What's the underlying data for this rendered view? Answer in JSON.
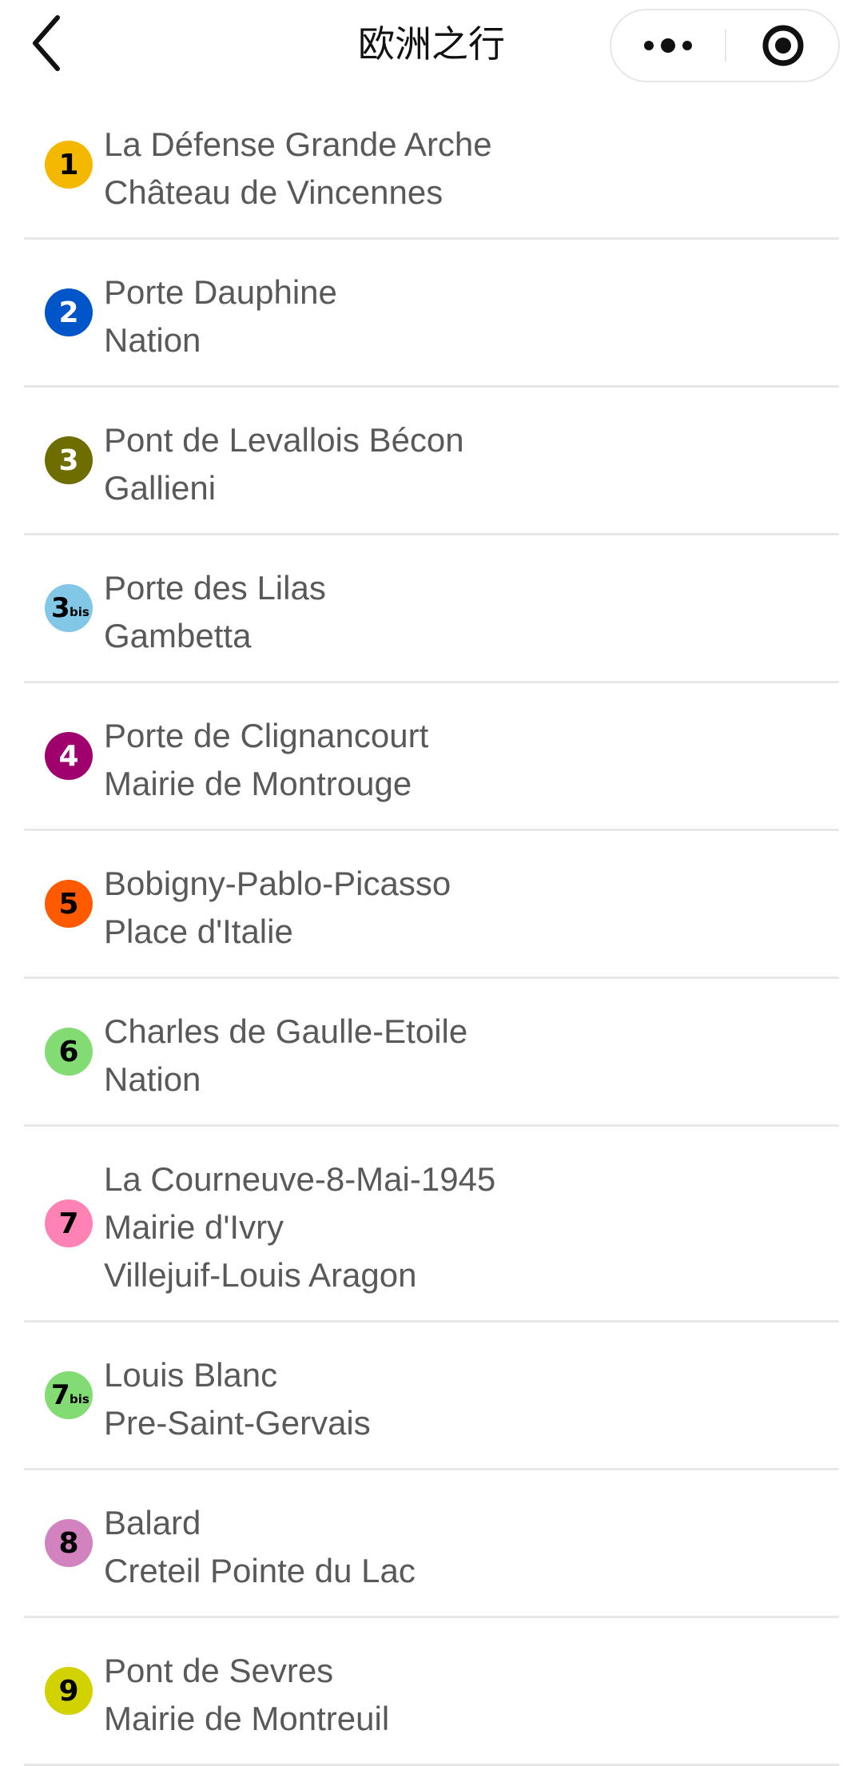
{
  "navbar": {
    "title": "欧洲之行",
    "back_icon": "chevron-left-icon",
    "more_icon": "more-dots-icon",
    "close_icon": "target-close-icon"
  },
  "lines": [
    {
      "id": "1",
      "label": "1",
      "suffix": "",
      "color": "#F5B800",
      "text_color": "#000000",
      "stations": [
        "La Défense Grande Arche",
        "Château de Vincennes"
      ]
    },
    {
      "id": "2",
      "label": "2",
      "suffix": "",
      "color": "#0055C8",
      "text_color": "#FFFFFF",
      "stations": [
        "Porte Dauphine",
        "Nation"
      ]
    },
    {
      "id": "3",
      "label": "3",
      "suffix": "",
      "color": "#6E6E00",
      "text_color": "#FFFFFF",
      "stations": [
        "Pont de Levallois Bécon",
        "Gallieni"
      ]
    },
    {
      "id": "3bis",
      "label": "3",
      "suffix": "bis",
      "color": "#82C8E6",
      "text_color": "#000000",
      "stations": [
        "Porte des Lilas",
        "Gambetta"
      ]
    },
    {
      "id": "4",
      "label": "4",
      "suffix": "",
      "color": "#A0006E",
      "text_color": "#FFFFFF",
      "stations": [
        "Porte de Clignancourt",
        "Mairie de Montrouge"
      ]
    },
    {
      "id": "5",
      "label": "5",
      "suffix": "",
      "color": "#FF5A00",
      "text_color": "#000000",
      "stations": [
        "Bobigny-Pablo-Picasso",
        "Place d'Italie"
      ]
    },
    {
      "id": "6",
      "label": "6",
      "suffix": "",
      "color": "#82DC73",
      "text_color": "#000000",
      "stations": [
        "Charles de Gaulle-Etoile",
        "Nation"
      ]
    },
    {
      "id": "7",
      "label": "7",
      "suffix": "",
      "color": "#FF82B4",
      "text_color": "#000000",
      "stations": [
        "La Courneuve-8-Mai-1945",
        "Mairie d'Ivry",
        "Villejuif-Louis Aragon"
      ]
    },
    {
      "id": "7bis",
      "label": "7",
      "suffix": "bis",
      "color": "#82DC73",
      "text_color": "#000000",
      "stations": [
        "Louis Blanc",
        "Pre-Saint-Gervais"
      ]
    },
    {
      "id": "8",
      "label": "8",
      "suffix": "",
      "color": "#D282BE",
      "text_color": "#000000",
      "stations": [
        "Balard",
        "Creteil Pointe du Lac"
      ]
    },
    {
      "id": "9",
      "label": "9",
      "suffix": "",
      "color": "#D2D200",
      "text_color": "#000000",
      "stations": [
        "Pont de Sevres",
        "Mairie de Montreuil"
      ]
    }
  ]
}
